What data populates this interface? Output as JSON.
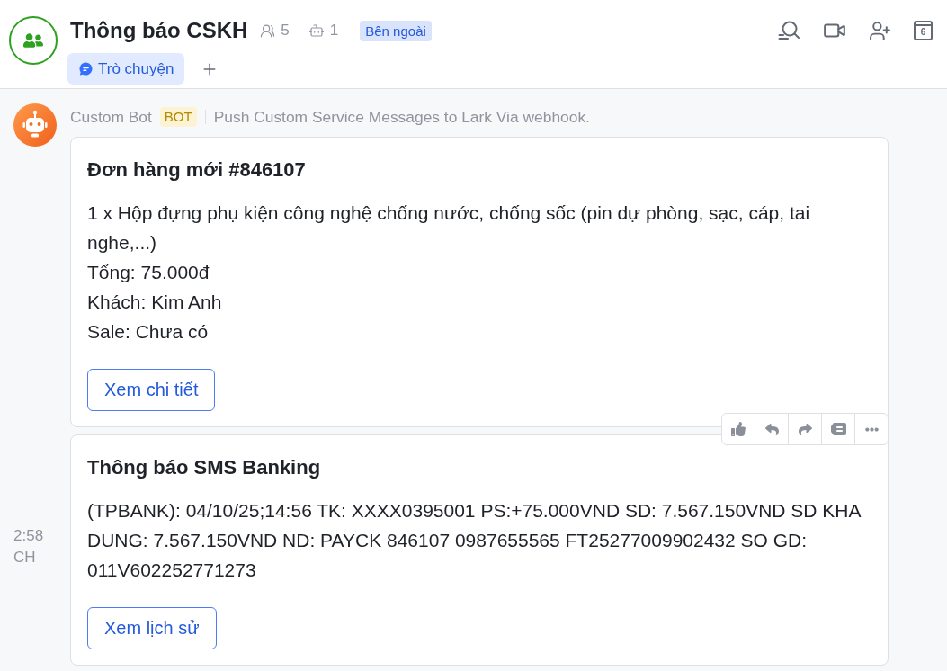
{
  "header": {
    "title": "Thông báo CSKH",
    "member_count": "5",
    "bot_count": "1",
    "tag": "Bên ngoài",
    "tabs": [
      {
        "label": "Trò chuyện",
        "selected": true
      }
    ],
    "calendar_day": "6"
  },
  "message": {
    "sender": "Custom Bot",
    "sender_tag": "BOT",
    "description": "Push Custom Service Messages to Lark Via webhook.",
    "cards": [
      {
        "title": "Đơn hàng mới #846107",
        "lines": [
          "1 x Hộp đựng phụ kiện công nghệ chống nước, chống sốc (pin dự phòng, sạc, cáp, tai nghe,...)",
          "Tổng: 75.000đ",
          "Khách: Kim Anh",
          "Sale: Chưa có"
        ],
        "button": "Xem chi tiết",
        "hovered": false
      },
      {
        "title": "Thông báo SMS Banking",
        "lines": [
          "(TPBANK): 04/10/25;14:56 TK: XXXX0395001 PS:+75.000VND SD: 7.567.150VND SD KHA DUNG: 7.567.150VND ND: PAYCK 846107 0987655565 FT25277009902432 SO GD: 011V602252771273"
        ],
        "button": "Xem lịch sử",
        "hovered": true,
        "time": "2:58 CH"
      }
    ]
  }
}
